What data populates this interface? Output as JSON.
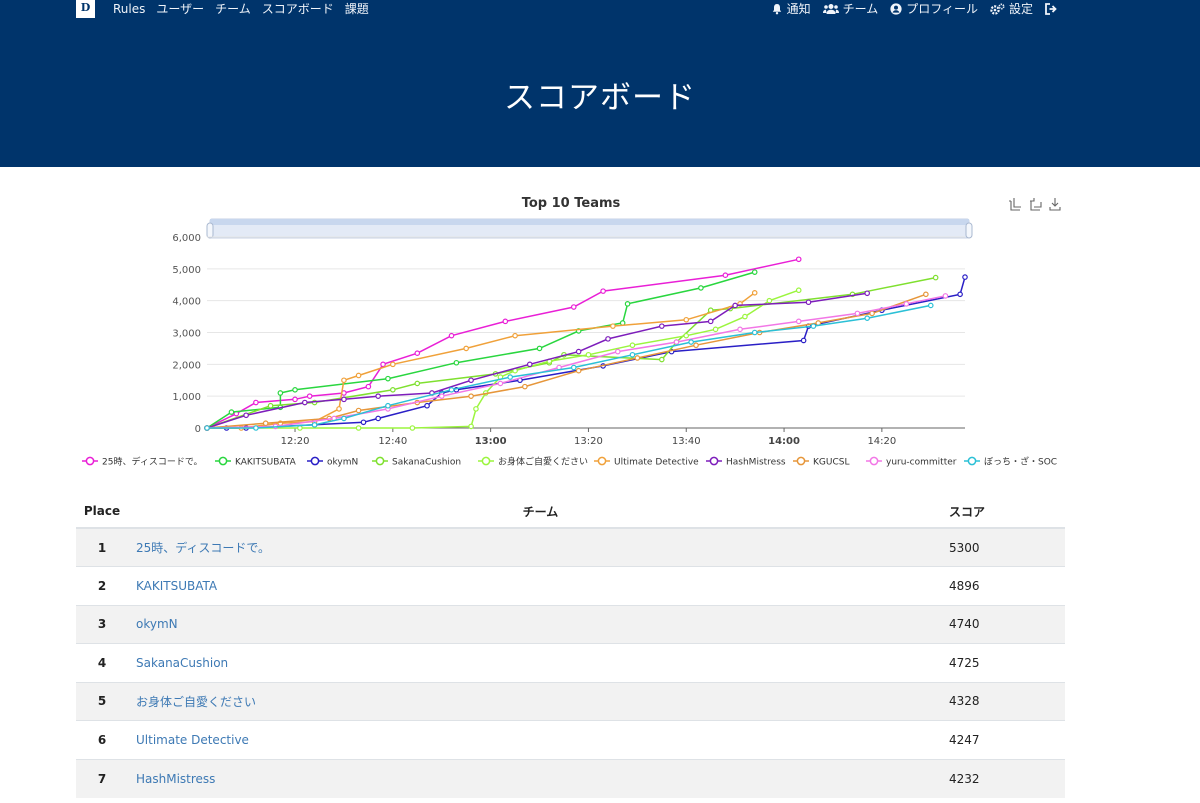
{
  "nav": {
    "logo": "D",
    "left_items": [
      "Rules",
      "ユーザー",
      "チーム",
      "スコアボード",
      "課題"
    ],
    "right_items": [
      {
        "label": "通知",
        "icon": "bell-icon"
      },
      {
        "label": "チーム",
        "icon": "users-icon"
      },
      {
        "label": "プロフィール",
        "icon": "user-circle-icon"
      },
      {
        "label": "設定",
        "icon": "gears-icon"
      },
      {
        "label": "",
        "icon": "sign-out-icon"
      }
    ]
  },
  "page_title": "スコアボード",
  "chart_toolbar": [
    "zoom-icon",
    "zoom-reset-icon",
    "download-icon"
  ],
  "chart_data": {
    "type": "line",
    "title": "Top 10 Teams",
    "xlabel": "",
    "ylabel": "",
    "x_ticks": [
      "12:20",
      "12:40",
      "13:00",
      "13:20",
      "13:40",
      "14:00",
      "14:20"
    ],
    "x_bold_ticks": [
      "13:00",
      "14:00"
    ],
    "y_ticks": [
      0,
      1000,
      2000,
      3000,
      4000,
      5000,
      6000
    ],
    "ylim": [
      0,
      6000
    ],
    "xlim": [
      "12:02",
      "14:37"
    ],
    "grid": true,
    "legend_position": "bottom",
    "series": [
      {
        "name": "25時、ディスコードで。",
        "color": "#e91fd6",
        "points": [
          [
            "12:02",
            0
          ],
          [
            "12:08",
            450
          ],
          [
            "12:12",
            800
          ],
          [
            "12:20",
            900
          ],
          [
            "12:23",
            1000
          ],
          [
            "12:30",
            1100
          ],
          [
            "12:35",
            1300
          ],
          [
            "12:38",
            2000
          ],
          [
            "12:45",
            2350
          ],
          [
            "12:52",
            2900
          ],
          [
            "13:03",
            3350
          ],
          [
            "13:17",
            3800
          ],
          [
            "13:23",
            4300
          ],
          [
            "13:48",
            4800
          ],
          [
            "14:03",
            5300
          ]
        ]
      },
      {
        "name": "KAKITSUBATA",
        "color": "#29d63f",
        "points": [
          [
            "12:02",
            0
          ],
          [
            "12:07",
            500
          ],
          [
            "12:17",
            650
          ],
          [
            "12:17",
            1100
          ],
          [
            "12:20",
            1200
          ],
          [
            "12:39",
            1550
          ],
          [
            "12:53",
            2050
          ],
          [
            "13:10",
            2500
          ],
          [
            "13:18",
            3050
          ],
          [
            "13:27",
            3300
          ],
          [
            "13:28",
            3900
          ],
          [
            "13:43",
            4400
          ],
          [
            "13:54",
            4896
          ]
        ]
      },
      {
        "name": "okymN",
        "color": "#2a1fc6",
        "points": [
          [
            "12:02",
            0
          ],
          [
            "12:06",
            0
          ],
          [
            "12:10",
            0
          ],
          [
            "12:24",
            100
          ],
          [
            "12:34",
            180
          ],
          [
            "12:37",
            300
          ],
          [
            "12:47",
            700
          ],
          [
            "12:50",
            1100
          ],
          [
            "12:53",
            1200
          ],
          [
            "13:06",
            1500
          ],
          [
            "13:23",
            1950
          ],
          [
            "13:37",
            2400
          ],
          [
            "14:04",
            2750
          ],
          [
            "14:05",
            3200
          ],
          [
            "14:20",
            3700
          ],
          [
            "14:36",
            4200
          ],
          [
            "14:37",
            4740
          ]
        ]
      },
      {
        "name": "SakanaCushion",
        "color": "#7fe02f",
        "points": [
          [
            "12:02",
            0
          ],
          [
            "12:15",
            700
          ],
          [
            "12:24",
            800
          ],
          [
            "12:40",
            1200
          ],
          [
            "12:45",
            1400
          ],
          [
            "13:01",
            1700
          ],
          [
            "13:12",
            2050
          ],
          [
            "13:15",
            2300
          ],
          [
            "13:35",
            2150
          ],
          [
            "13:38",
            2700
          ],
          [
            "13:45",
            3700
          ],
          [
            "13:49",
            3750
          ],
          [
            "14:14",
            4200
          ],
          [
            "14:31",
            4725
          ]
        ]
      },
      {
        "name": "お身体ご自愛ください",
        "color": "#9bf53e",
        "points": [
          [
            "12:02",
            0
          ],
          [
            "12:21",
            0
          ],
          [
            "12:33",
            0
          ],
          [
            "12:44",
            0
          ],
          [
            "12:56",
            50
          ],
          [
            "12:57",
            600
          ],
          [
            "12:59",
            1100
          ],
          [
            "13:02",
            1600
          ],
          [
            "13:05",
            1800
          ],
          [
            "13:12",
            2100
          ],
          [
            "13:20",
            2300
          ],
          [
            "13:29",
            2600
          ],
          [
            "13:40",
            2900
          ],
          [
            "13:46",
            3100
          ],
          [
            "13:52",
            3500
          ],
          [
            "13:57",
            4000
          ],
          [
            "14:03",
            4328
          ]
        ]
      },
      {
        "name": "Ultimate Detective",
        "color": "#f0a13a",
        "points": [
          [
            "12:02",
            0
          ],
          [
            "12:09",
            0
          ],
          [
            "12:17",
            150
          ],
          [
            "12:24",
            200
          ],
          [
            "12:29",
            600
          ],
          [
            "12:30",
            1500
          ],
          [
            "12:33",
            1650
          ],
          [
            "12:40",
            2000
          ],
          [
            "12:55",
            2500
          ],
          [
            "13:05",
            2900
          ],
          [
            "13:25",
            3200
          ],
          [
            "13:40",
            3400
          ],
          [
            "13:51",
            3900
          ],
          [
            "13:54",
            4247
          ]
        ]
      },
      {
        "name": "HashMistress",
        "color": "#7d1dbb",
        "points": [
          [
            "12:02",
            0
          ],
          [
            "12:10",
            400
          ],
          [
            "12:22",
            800
          ],
          [
            "12:30",
            900
          ],
          [
            "12:37",
            1000
          ],
          [
            "12:48",
            1100
          ],
          [
            "12:56",
            1500
          ],
          [
            "13:08",
            2000
          ],
          [
            "13:18",
            2400
          ],
          [
            "13:24",
            2800
          ],
          [
            "13:35",
            3200
          ],
          [
            "13:45",
            3350
          ],
          [
            "13:50",
            3850
          ],
          [
            "14:05",
            3950
          ],
          [
            "14:17",
            4232
          ]
        ]
      },
      {
        "name": "KGUCSL",
        "color": "#e6963a",
        "points": [
          [
            "12:02",
            0
          ],
          [
            "12:14",
            150
          ],
          [
            "12:27",
            300
          ],
          [
            "12:33",
            550
          ],
          [
            "12:45",
            800
          ],
          [
            "12:56",
            1000
          ],
          [
            "13:07",
            1300
          ],
          [
            "13:18",
            1800
          ],
          [
            "13:30",
            2200
          ],
          [
            "13:42",
            2600
          ],
          [
            "13:55",
            3000
          ],
          [
            "14:07",
            3300
          ],
          [
            "14:18",
            3600
          ],
          [
            "14:29",
            4200
          ]
        ]
      },
      {
        "name": "yuru-committer",
        "color": "#f277e6",
        "points": [
          [
            "12:02",
            0
          ],
          [
            "12:16",
            50
          ],
          [
            "12:28",
            300
          ],
          [
            "12:39",
            600
          ],
          [
            "12:50",
            1000
          ],
          [
            "13:02",
            1400
          ],
          [
            "13:14",
            1900
          ],
          [
            "13:26",
            2400
          ],
          [
            "13:38",
            2700
          ],
          [
            "13:51",
            3100
          ],
          [
            "14:03",
            3350
          ],
          [
            "14:15",
            3600
          ],
          [
            "14:25",
            3900
          ],
          [
            "14:33",
            4150
          ]
        ]
      },
      {
        "name": "ぼっち・ざ・SOC",
        "color": "#2bc0d6",
        "points": [
          [
            "12:02",
            0
          ],
          [
            "12:12",
            0
          ],
          [
            "12:24",
            100
          ],
          [
            "12:30",
            300
          ],
          [
            "12:39",
            700
          ],
          [
            "12:52",
            1200
          ],
          [
            "13:04",
            1600
          ],
          [
            "13:17",
            1900
          ],
          [
            "13:29",
            2300
          ],
          [
            "13:41",
            2700
          ],
          [
            "13:54",
            3000
          ],
          [
            "14:06",
            3200
          ],
          [
            "14:17",
            3450
          ],
          [
            "14:30",
            3850
          ]
        ]
      }
    ]
  },
  "table": {
    "headers": {
      "place": "Place",
      "team": "チーム",
      "score": "スコア"
    },
    "rows": [
      {
        "place": "1",
        "team": "25時、ディスコードで。",
        "score": "5300"
      },
      {
        "place": "2",
        "team": "KAKITSUBATA",
        "score": "4896"
      },
      {
        "place": "3",
        "team": "okymN",
        "score": "4740"
      },
      {
        "place": "4",
        "team": "SakanaCushion",
        "score": "4725"
      },
      {
        "place": "5",
        "team": "お身体ご自愛ください",
        "score": "4328"
      },
      {
        "place": "6",
        "team": "Ultimate Detective",
        "score": "4247"
      },
      {
        "place": "7",
        "team": "HashMistress",
        "score": "4232"
      }
    ]
  }
}
